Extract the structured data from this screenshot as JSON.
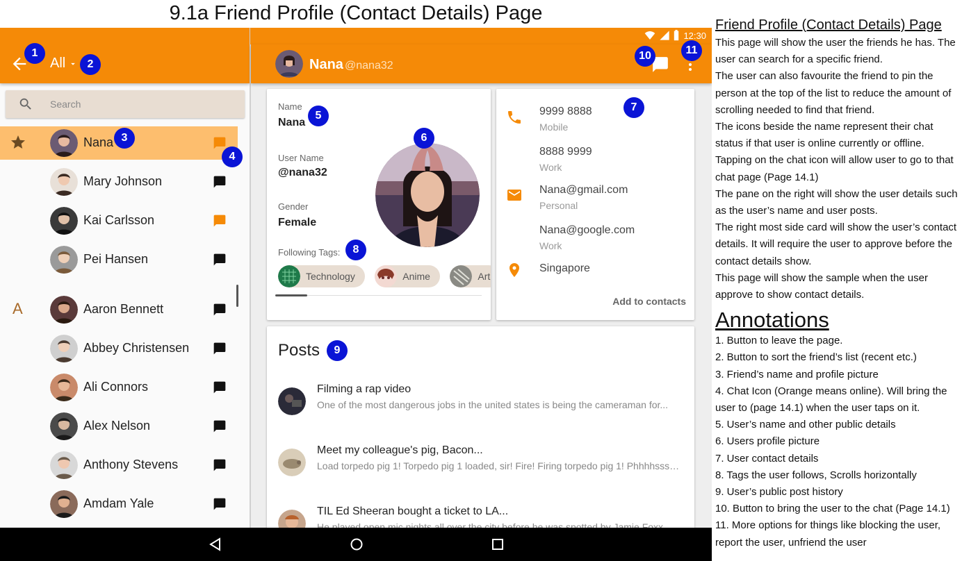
{
  "page_title": "9.1a Friend Profile (Contact Details) Page",
  "status_bar": {
    "time": "12:30"
  },
  "left_appbar": {
    "sort_label": "All"
  },
  "search": {
    "placeholder": "Search"
  },
  "friends": [
    {
      "name": "Nana",
      "status": "online",
      "favorite": true
    },
    {
      "name": "Mary Johnson",
      "status": "offline"
    },
    {
      "name": "Kai Carlsson",
      "status": "online"
    },
    {
      "name": "Pei Hansen",
      "status": "offline"
    },
    {
      "name": "Aaron Bennett",
      "status": "offline",
      "section_letter": "A"
    },
    {
      "name": "Abbey Christensen",
      "status": "offline"
    },
    {
      "name": "Ali Connors",
      "status": "offline"
    },
    {
      "name": "Alex Nelson",
      "status": "offline"
    },
    {
      "name": "Anthony Stevens",
      "status": "offline"
    },
    {
      "name": "Amdam Yale",
      "status": "offline"
    }
  ],
  "profile_header": {
    "name": "Nana",
    "handle": "@nana32"
  },
  "profile": {
    "name_label": "Name",
    "name": "Nana",
    "username_label": "User Name",
    "username": "@nana32",
    "gender_label": "Gender",
    "gender": "Female",
    "tags_label": "Following Tags:",
    "tags": [
      "Technology",
      "Anime",
      "Art"
    ]
  },
  "contact": {
    "phones": [
      {
        "value": "9999 8888",
        "type": "Mobile"
      },
      {
        "value": "8888 9999",
        "type": "Work"
      }
    ],
    "emails": [
      {
        "value": "Nana@gmail.com",
        "type": "Personal"
      },
      {
        "value": "Nana@google.com",
        "type": "Work"
      }
    ],
    "location": "Singapore",
    "add_label": "Add to contacts"
  },
  "posts": {
    "title": "Posts",
    "items": [
      {
        "title": "Filming a rap video",
        "body": "One of the most dangerous jobs in the united states is being the cameraman for..."
      },
      {
        "title": "Meet my colleague's pig, Bacon...",
        "body": "Load torpedo pig 1! Torpedo pig 1 loaded, sir! Fire! Firing torpedo pig 1! Phhhhssss..."
      },
      {
        "title": "TIL Ed Sheeran bought a ticket to LA...",
        "body": "He played open mic nights all over the city before he was spotted by Jamie Foxx..."
      }
    ]
  },
  "badges": [
    "1",
    "2",
    "3",
    "4",
    "5",
    "6",
    "7",
    "8",
    "9",
    "10",
    "11"
  ],
  "notes": {
    "title": "Friend Profile (Contact Details) Page",
    "paragraphs": [
      "This page will show the user the friends he has. The user can search for a specific friend.",
      "The user can also favourite the friend to pin the person at the top of the list to reduce the amount of scrolling needed to find that friend.",
      "The icons beside the name represent their chat status if that user is online currently or offline.",
      "Tapping on the chat icon will allow user to go to that chat page (Page 14.1)",
      "The pane on the right will show the user details such as the user’s name and user posts.",
      "The right most side card will show the user’s contact details. It will require the user to approve before the contact details show.",
      "This page will show the sample when the user approve to show contact details."
    ],
    "annotations_title": "Annotations",
    "annotations": [
      "1. Button to leave the page.",
      "2. Button to sort the friend’s list (recent etc.)",
      "3. Friend’s name and profile picture",
      "4. Chat Icon (Orange means online). Will bring the user to (page 14.1) when the user taps on it.",
      "5. User’s name and other public details",
      "6. Users profile picture",
      "7. User contact details",
      "8. Tags the user follows, Scrolls horizontally",
      "9. User’s public post history",
      "10. Button to bring the user to the chat (Page 14.1)",
      "11. More options for things like blocking the user, report the user, unfriend the user"
    ]
  },
  "colors": {
    "accent": "#f58a07",
    "online": "#f58a07",
    "offline": "#111111",
    "badge": "#0a14d6"
  }
}
